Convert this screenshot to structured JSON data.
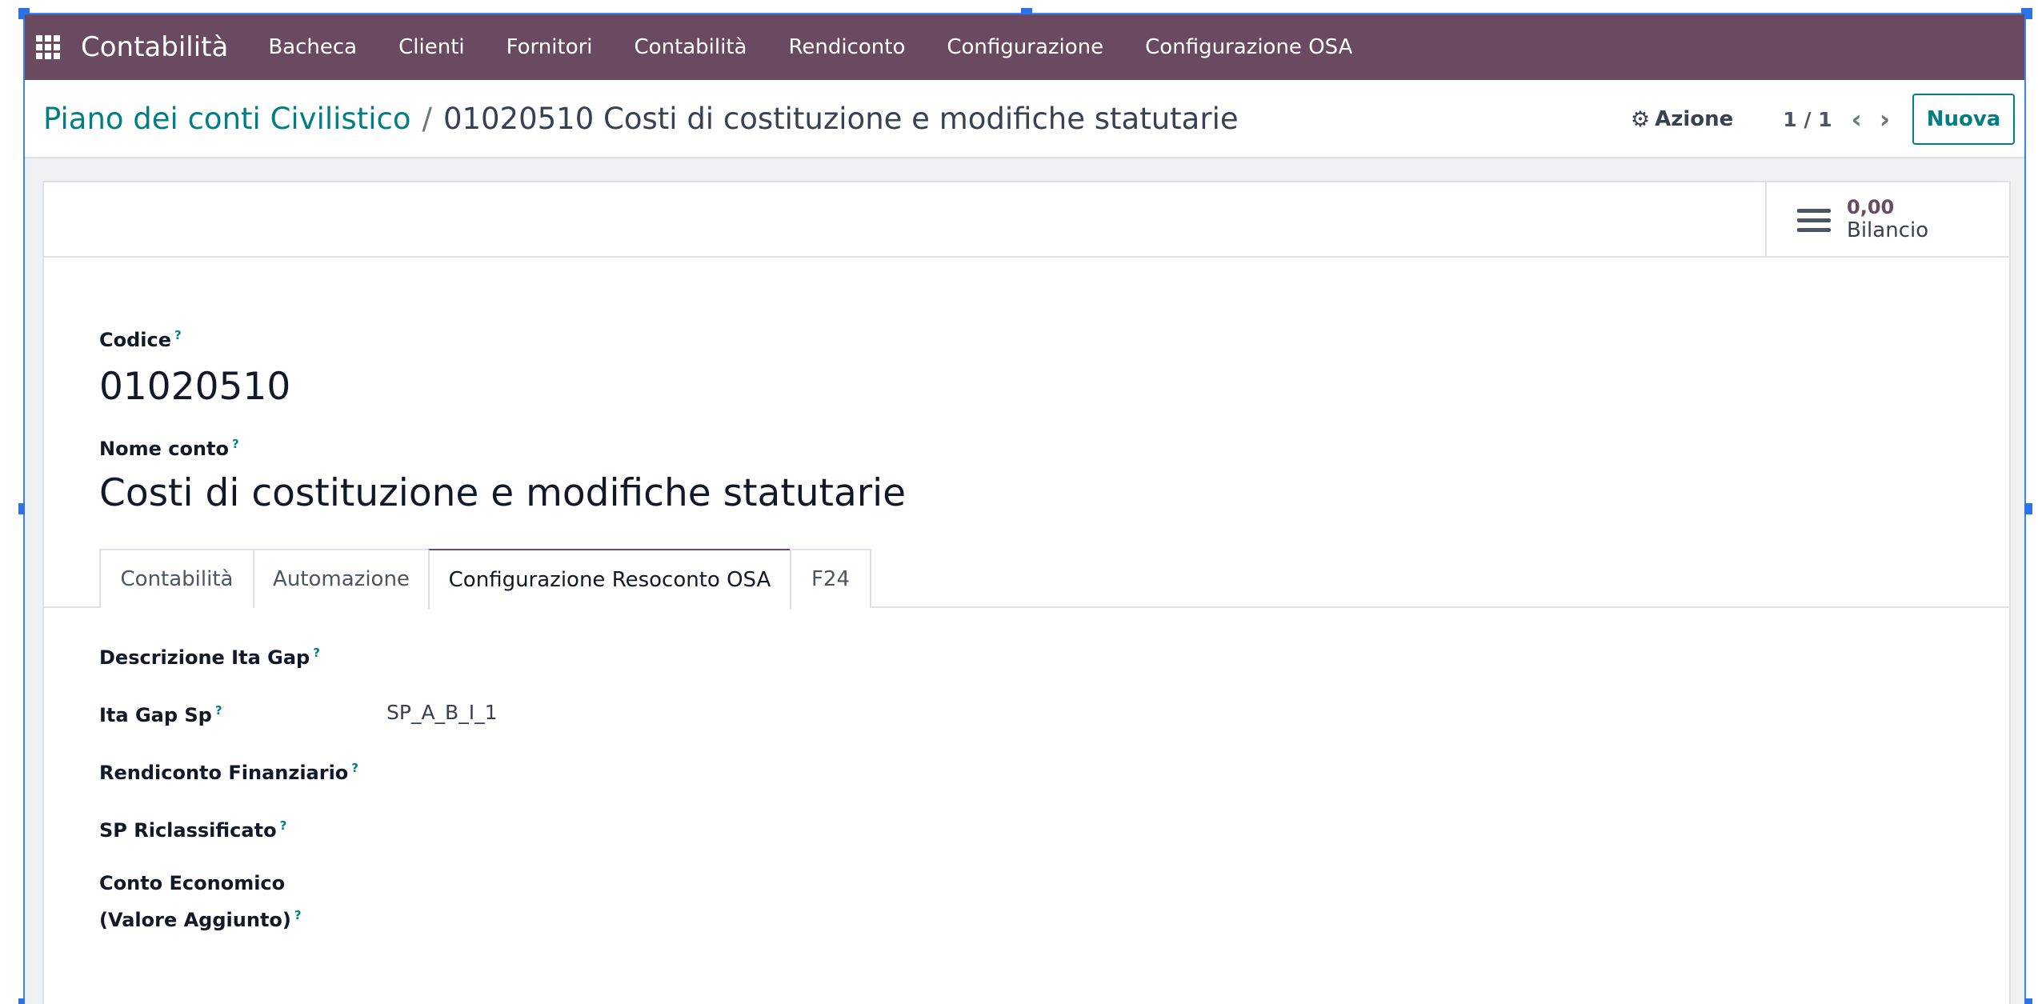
{
  "navbar": {
    "brand": "Contabilità",
    "menu": [
      "Bacheca",
      "Clienti",
      "Fornitori",
      "Contabilità",
      "Rendiconto",
      "Configurazione",
      "Configurazione OSA"
    ]
  },
  "breadcrumb": {
    "parent": "Piano dei conti Civilistico",
    "separator": "/",
    "current": "01020510 Costi di costituzione e modifiche statutarie"
  },
  "control": {
    "action_label": "Azione",
    "pager": "1 / 1",
    "new_label": "Nuova"
  },
  "stat_button": {
    "value": "0,00",
    "label": "Bilancio"
  },
  "form": {
    "code_label": "Codice",
    "code_value": "01020510",
    "name_label": "Nome conto",
    "name_value": "Costi di costituzione e modifiche statutarie",
    "help_mark": "?"
  },
  "tabs": [
    "Contabilità",
    "Automazione",
    "Configurazione Resoconto OSA",
    "F24"
  ],
  "active_tab": "Configurazione Resoconto OSA",
  "osa_fields": {
    "descrizione_ita_gap": {
      "label": "Descrizione Ita Gap",
      "value": ""
    },
    "ita_gap_sp": {
      "label": "Ita Gap Sp",
      "value": "SP_A_B_I_1"
    },
    "rendiconto_finanziario": {
      "label": "Rendiconto Finanziario",
      "value": ""
    },
    "sp_riclassificato": {
      "label": "SP Riclassificato",
      "value": ""
    },
    "conto_economico_line1": "Conto Economico",
    "conto_economico_line2": "(Valore Aggiunto)"
  },
  "colors": {
    "navbar": "#6a4a60",
    "link": "#017e84",
    "accent": "#6a4a60"
  }
}
